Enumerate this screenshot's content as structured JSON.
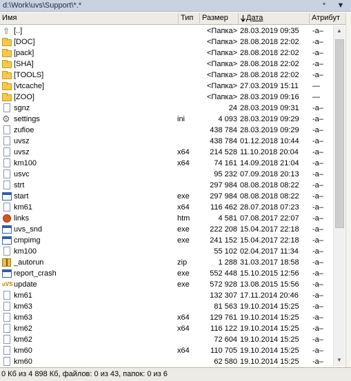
{
  "path_bar": {
    "path": "d:\\Work\\uvs\\Support\\*.*",
    "star_button": "*",
    "dropdown_button": "▼"
  },
  "columns": {
    "name": "Имя",
    "type": "Тип",
    "size": "Размер",
    "date": "Дата",
    "attr": "Атрибут",
    "sort_indicator": "arrow-down-icon"
  },
  "files": [
    {
      "name": "[..]",
      "ext": "",
      "size": "<Папка>",
      "date": "28.03.2019 09:35",
      "attr": "-a–",
      "icon": "up-folder-icon"
    },
    {
      "name": "[DOC]",
      "ext": "",
      "size": "<Папка>",
      "date": "28.08.2018 22:02",
      "attr": "-a–",
      "icon": "folder-icon"
    },
    {
      "name": "[pack]",
      "ext": "",
      "size": "<Папка>",
      "date": "28.08.2018 22:02",
      "attr": "-a–",
      "icon": "folder-icon"
    },
    {
      "name": "[SHA]",
      "ext": "",
      "size": "<Папка>",
      "date": "28.08.2018 22:02",
      "attr": "-a–",
      "icon": "folder-icon"
    },
    {
      "name": "[TOOLS]",
      "ext": "",
      "size": "<Папка>",
      "date": "28.08.2018 22:02",
      "attr": "-a–",
      "icon": "folder-icon"
    },
    {
      "name": "[vtcache]",
      "ext": "",
      "size": "<Папка>",
      "date": "27.03.2019 15:11",
      "attr": "—",
      "icon": "folder-icon"
    },
    {
      "name": "[ZOO]",
      "ext": "",
      "size": "<Папка>",
      "date": "28.03.2019 09:16",
      "attr": "—",
      "icon": "folder-icon"
    },
    {
      "name": "sgnz",
      "ext": "",
      "size": "24",
      "date": "28.03.2019 09:31",
      "attr": "-a–",
      "icon": "document-icon"
    },
    {
      "name": "settings",
      "ext": "ini",
      "size": "4 093",
      "date": "28.03.2019 09:29",
      "attr": "-a–",
      "icon": "gear-icon"
    },
    {
      "name": "zufioe",
      "ext": "",
      "size": "438 784",
      "date": "28.03.2019 09:29",
      "attr": "-a–",
      "icon": "document-icon"
    },
    {
      "name": "uvsz",
      "ext": "",
      "size": "438 784",
      "date": "01.12.2018 10:44",
      "attr": "-a–",
      "icon": "document-icon"
    },
    {
      "name": "uvsz",
      "ext": "x64",
      "size": "214 528",
      "date": "11.10.2018 20:04",
      "attr": "-a–",
      "icon": "document-icon"
    },
    {
      "name": "km100",
      "ext": "x64",
      "size": "74 161",
      "date": "14.09.2018 21:04",
      "attr": "-a–",
      "icon": "document-icon"
    },
    {
      "name": "usvc",
      "ext": "",
      "size": "95 232",
      "date": "07.09.2018 20:13",
      "attr": "-a–",
      "icon": "document-icon"
    },
    {
      "name": "strt",
      "ext": "",
      "size": "297 984",
      "date": "08.08.2018 08:22",
      "attr": "-a–",
      "icon": "document-icon"
    },
    {
      "name": "start",
      "ext": "exe",
      "size": "297 984",
      "date": "08.08.2018 08:22",
      "attr": "-a–",
      "icon": "application-icon"
    },
    {
      "name": "km61",
      "ext": "x64",
      "size": "116 462",
      "date": "28.07.2018 07:23",
      "attr": "-a–",
      "icon": "document-icon"
    },
    {
      "name": "links",
      "ext": "htm",
      "size": "4 581",
      "date": "07.08.2017 22:07",
      "attr": "-a–",
      "icon": "web-page-icon"
    },
    {
      "name": "uvs_snd",
      "ext": "exe",
      "size": "222 208",
      "date": "15.04.2017 22:18",
      "attr": "-a–",
      "icon": "application-icon"
    },
    {
      "name": "cmpimg",
      "ext": "exe",
      "size": "241 152",
      "date": "15.04.2017 22:18",
      "attr": "-a–",
      "icon": "application-icon"
    },
    {
      "name": "km100",
      "ext": "",
      "size": "55 102",
      "date": "02.04.2017 11:34",
      "attr": "-a–",
      "icon": "document-icon"
    },
    {
      "name": "_autorun",
      "ext": "zip",
      "size": "1 288",
      "date": "31.03.2017 18:58",
      "attr": "-a–",
      "icon": "archive-icon"
    },
    {
      "name": "report_crash",
      "ext": "exe",
      "size": "552 448",
      "date": "15.10.2015 12:56",
      "attr": "-a–",
      "icon": "application-icon"
    },
    {
      "name": "update",
      "ext": "exe",
      "size": "572 928",
      "date": "13.08.2015 15:56",
      "attr": "-a–",
      "icon": "uvs-logo-icon"
    },
    {
      "name": "km61",
      "ext": "",
      "size": "132 307",
      "date": "17.11.2014 20:46",
      "attr": "-a–",
      "icon": "document-icon"
    },
    {
      "name": "km63",
      "ext": "",
      "size": "81 563",
      "date": "19.10.2014 15:25",
      "attr": "-a–",
      "icon": "document-icon"
    },
    {
      "name": "km63",
      "ext": "x64",
      "size": "129 761",
      "date": "19.10.2014 15:25",
      "attr": "-a–",
      "icon": "document-icon"
    },
    {
      "name": "km62",
      "ext": "x64",
      "size": "116 122",
      "date": "19.10.2014 15:25",
      "attr": "-a–",
      "icon": "document-icon"
    },
    {
      "name": "km62",
      "ext": "",
      "size": "72 604",
      "date": "19.10.2014 15:25",
      "attr": "-a–",
      "icon": "document-icon"
    },
    {
      "name": "km60",
      "ext": "x64",
      "size": "110 705",
      "date": "19.10.2014 15:25",
      "attr": "-a–",
      "icon": "document-icon"
    },
    {
      "name": "km60",
      "ext": "",
      "size": "62 580",
      "date": "19.10.2014 15:25",
      "attr": "-a–",
      "icon": "document-icon"
    }
  ],
  "status_bar": {
    "text": "0 Кб из 4 898 Кб, файлов: 0 из 43, папок: 0 из 6"
  },
  "scrollbar": {
    "up_arrow": "▲",
    "down_arrow": "▼"
  }
}
